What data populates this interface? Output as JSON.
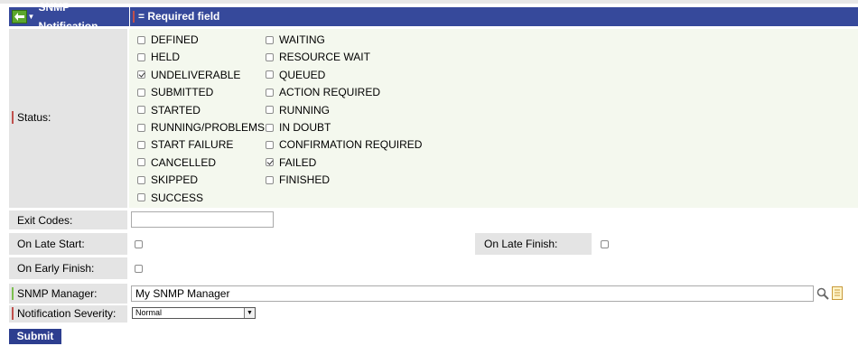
{
  "header": {
    "title": "SNMP Notification",
    "required_legend": "= Required field"
  },
  "status": {
    "label": "Status:",
    "column1": [
      {
        "label": "DEFINED",
        "checked": false
      },
      {
        "label": "HELD",
        "checked": false
      },
      {
        "label": "UNDELIVERABLE",
        "checked": true
      },
      {
        "label": "SUBMITTED",
        "checked": false
      },
      {
        "label": "STARTED",
        "checked": false
      },
      {
        "label": "RUNNING/PROBLEMS",
        "checked": false
      },
      {
        "label": "START FAILURE",
        "checked": false
      },
      {
        "label": "CANCELLED",
        "checked": false
      },
      {
        "label": "SKIPPED",
        "checked": false
      },
      {
        "label": "SUCCESS",
        "checked": false
      }
    ],
    "column2": [
      {
        "label": "WAITING",
        "checked": false
      },
      {
        "label": "RESOURCE WAIT",
        "checked": false
      },
      {
        "label": "QUEUED",
        "checked": false
      },
      {
        "label": "ACTION REQUIRED",
        "checked": false
      },
      {
        "label": "RUNNING",
        "checked": false
      },
      {
        "label": "IN DOUBT",
        "checked": false
      },
      {
        "label": "CONFIRMATION REQUIRED",
        "checked": false
      },
      {
        "label": "FAILED",
        "checked": true
      },
      {
        "label": "FINISHED",
        "checked": false
      }
    ]
  },
  "exit_codes": {
    "label": "Exit Codes:",
    "value": ""
  },
  "on_late_start": {
    "label": "On Late Start:",
    "checked": false
  },
  "on_late_finish": {
    "label": "On Late Finish:",
    "checked": false
  },
  "on_early_finish": {
    "label": "On Early Finish:",
    "checked": false
  },
  "snmp_manager": {
    "label": "SNMP Manager:",
    "value": "My SNMP Manager"
  },
  "notification_severity": {
    "label": "Notification Severity:",
    "value": "Normal"
  },
  "submit_label": "Submit",
  "colors": {
    "header": "#36499b",
    "required_marker": "#c0504d",
    "valid_marker": "#7bbf4f",
    "submit": "#2d3e8f"
  }
}
